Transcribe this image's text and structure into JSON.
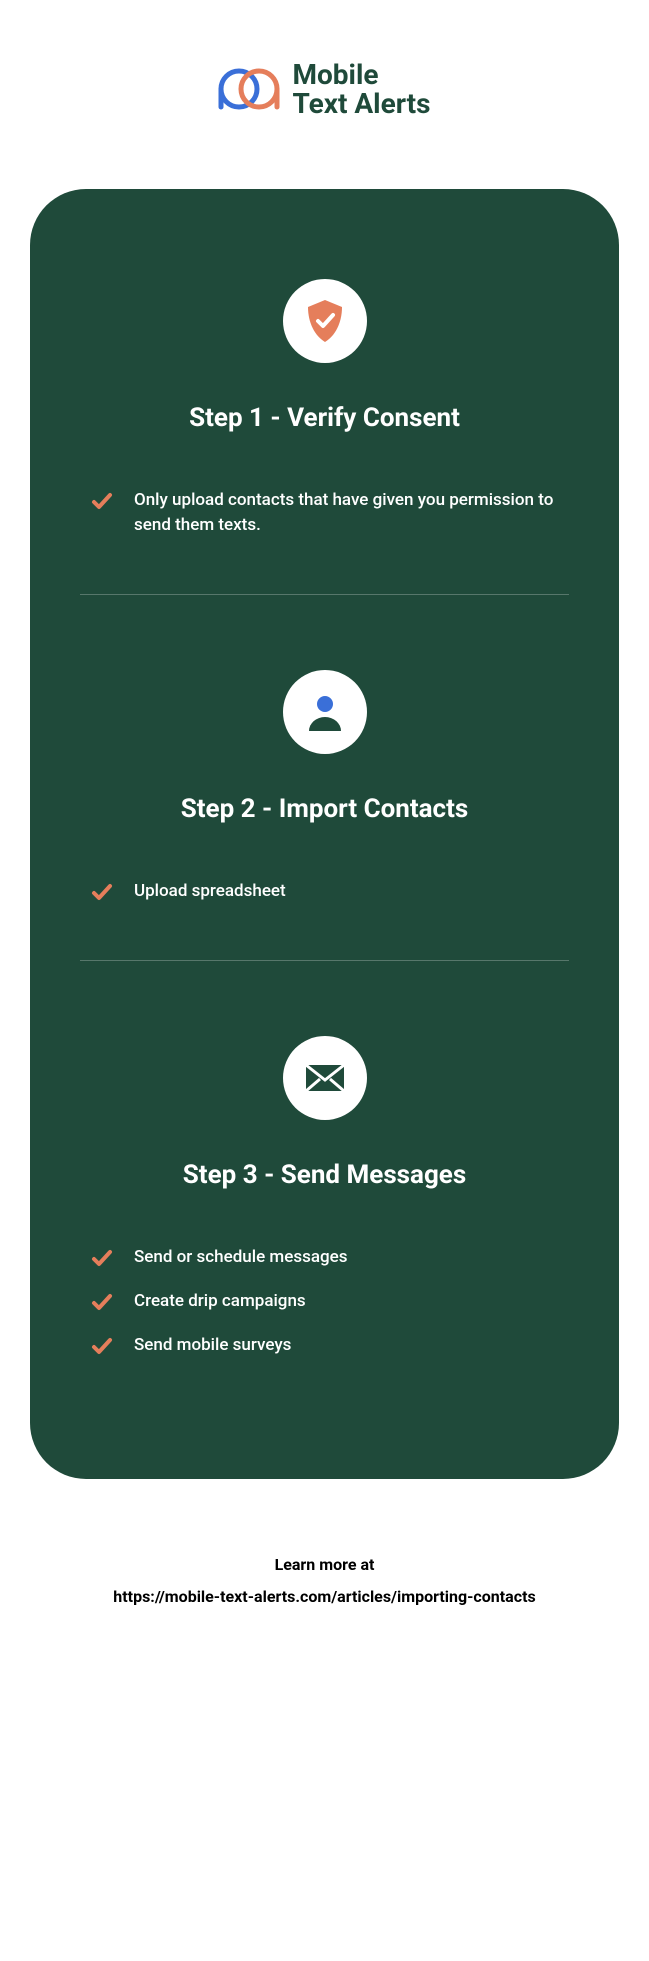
{
  "brand": {
    "line1": "Mobile",
    "line2": "Text Alerts"
  },
  "steps": [
    {
      "title": "Step 1 - Verify Consent",
      "items": [
        "Only upload contacts that have given you permission to send them texts."
      ]
    },
    {
      "title": "Step 2 - Import Contacts",
      "items": [
        "Upload spreadsheet"
      ]
    },
    {
      "title": "Step 3 - Send Messages",
      "items": [
        "Send or schedule messages",
        "Create drip campaigns",
        "Send mobile surveys"
      ]
    }
  ],
  "footer": {
    "learn": "Learn more at",
    "url": "https://mobile-text-alerts.com/articles/importing-contacts"
  },
  "colors": {
    "card_bg": "#1f4a3a",
    "accent": "#e57e5b",
    "blue": "#3a6fd8"
  }
}
